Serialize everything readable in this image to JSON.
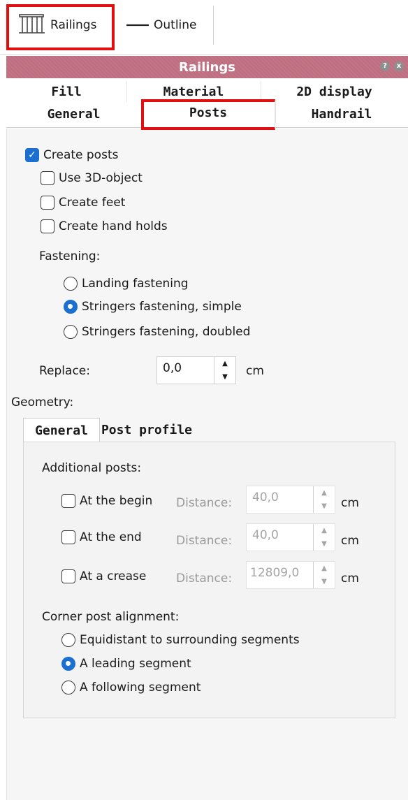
{
  "toolbar": {
    "railings_label": "Railings",
    "outline_label": "Outline"
  },
  "panel": {
    "title": "Railings",
    "help_icon": "?",
    "close_icon": "x"
  },
  "tabs": {
    "row1": [
      "Fill",
      "Material",
      "2D display"
    ],
    "row2": [
      "General",
      "Posts",
      "Handrail"
    ]
  },
  "posts": {
    "create_posts": "Create posts",
    "use_3d_object": "Use 3D-object",
    "create_feet": "Create feet",
    "create_hand_holds": "Create hand holds",
    "fastening_label": "Fastening:",
    "fastening_options": [
      "Landing fastening",
      "Stringers fastening, simple",
      "Stringers fastening, doubled"
    ],
    "replace_label": "Replace:",
    "replace_value": "0,0",
    "replace_unit": "cm",
    "geometry_label": "Geometry:"
  },
  "geometry": {
    "tabs": [
      "General",
      "Post profile"
    ],
    "additional_posts_label": "Additional posts:",
    "rows": [
      {
        "label": "At the begin",
        "distance_label": "Distance:",
        "value": "40,0",
        "unit": "cm"
      },
      {
        "label": "At the end",
        "distance_label": "Distance:",
        "value": "40,0",
        "unit": "cm"
      },
      {
        "label": "At a crease",
        "distance_label": "Distance:",
        "value": "12809,0",
        "unit": "cm"
      }
    ],
    "corner_label": "Corner post alignment:",
    "corner_options": [
      "Equidistant to surrounding segments",
      "A leading segment",
      "A following segment"
    ]
  },
  "colors": {
    "title_bar": "#c17586",
    "accent": "#1b6fd1",
    "highlight": "#e01010"
  }
}
